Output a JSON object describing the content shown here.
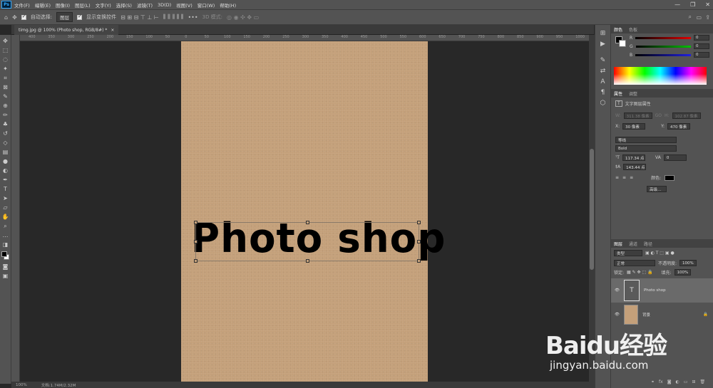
{
  "menu": {
    "logo": "Ps",
    "items": [
      "文件(F)",
      "编辑(E)",
      "图像(I)",
      "图层(L)",
      "文字(Y)",
      "选择(S)",
      "滤镜(T)",
      "3D(D)",
      "视图(V)",
      "窗口(W)",
      "帮助(H)"
    ],
    "window_controls": [
      "—",
      "❐",
      "✕"
    ]
  },
  "options": {
    "auto_select_label": "自动选择:",
    "auto_select_value": "图层",
    "show_transform_label": "显示变换控件",
    "mode_3d_label": "3D 模式:"
  },
  "document": {
    "tab_title": "timg.jpg @ 100% (Photo shop, RGB/8#) *",
    "close": "×",
    "canvas_text": "Photo shop",
    "zoom": "100%",
    "doc_info": "文档:1.74M/2.32M"
  },
  "ruler": {
    "h_labels": [
      "400",
      "350",
      "300",
      "250",
      "200",
      "150",
      "100",
      "50",
      "0",
      "50",
      "100",
      "150",
      "200",
      "250",
      "300",
      "350",
      "400",
      "450",
      "500",
      "550",
      "600",
      "650",
      "700",
      "750",
      "800",
      "850",
      "900",
      "950",
      "1000"
    ]
  },
  "color_panel": {
    "tabs": [
      "颜色",
      "色板"
    ],
    "channels": [
      {
        "label": "R",
        "value": "0"
      },
      {
        "label": "G",
        "value": "0"
      },
      {
        "label": "B",
        "value": "0"
      }
    ],
    "colors": {
      "r": "#e00000",
      "g": "#00c000",
      "b": "#2020e0"
    }
  },
  "properties": {
    "tabs": [
      "属性",
      "调整"
    ],
    "type_label": "文字图层属性",
    "w_label": "W:",
    "w_value": "311.38 像素",
    "link_label": "GO",
    "h_label": "H:",
    "h_value": "102.87 像素",
    "x_label": "X:",
    "x_value": "30 像素",
    "y_label": "Y:",
    "y_value": "470 像素",
    "font_family": "等线",
    "font_style": "Bold",
    "font_size": "117.34 点",
    "tracking": "0",
    "leading": "143.44 点",
    "color_label": "颜色:",
    "advanced_button": "高级..."
  },
  "layers": {
    "tabs": [
      "图层",
      "通道",
      "路径"
    ],
    "filter_label": "类型",
    "blend_mode": "正常",
    "opacity_label": "不透明度:",
    "opacity_value": "100%",
    "lock_label": "锁定:",
    "fill_label": "填充:",
    "fill_value": "100%",
    "items": [
      {
        "name": "Photo shop",
        "thumb": "T"
      },
      {
        "name": "背景"
      }
    ]
  },
  "watermark": {
    "brand": "Baidu经验",
    "url": "jingyan.baidu.com"
  }
}
